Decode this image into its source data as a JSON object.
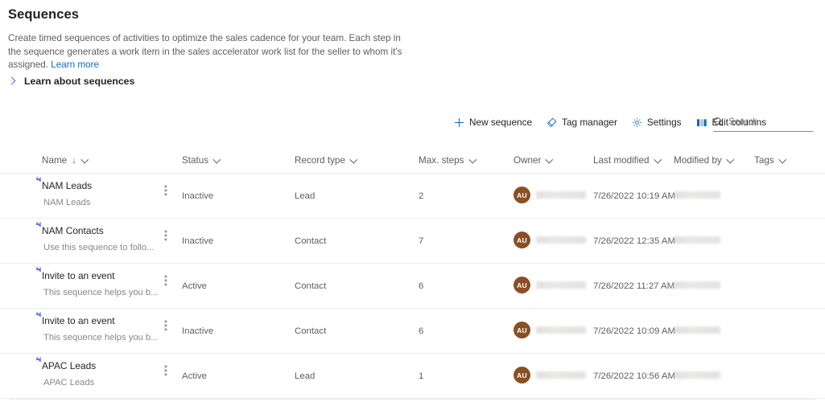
{
  "header": {
    "title": "Sequences",
    "description_part1": "Create timed sequences of activities to optimize the sales cadence for your team. Each step in the sequence generates a work item in the sales accelerator work list for the seller to whom it's assigned. ",
    "learn_more_label": "Learn more"
  },
  "expander": {
    "label": "Learn about sequences",
    "icon": "chevron-right-icon"
  },
  "toolbar": {
    "new_sequence_label": "New sequence",
    "new_sequence_icon": "plus-icon",
    "tag_manager_label": "Tag manager",
    "tag_manager_icon": "tag-icon",
    "settings_label": "Settings",
    "settings_icon": "gear-icon",
    "edit_columns_label": "Edit columns",
    "edit_columns_icon": "columns-icon"
  },
  "search": {
    "placeholder": "Search",
    "icon": "search-icon"
  },
  "table": {
    "columns": [
      {
        "label": "Name",
        "sorted": "↓"
      },
      {
        "label": "Status",
        "sorted": ""
      },
      {
        "label": "Record type",
        "sorted": ""
      },
      {
        "label": "Max. steps",
        "sorted": ""
      },
      {
        "label": "Owner",
        "sorted": ""
      },
      {
        "label": "Last modified",
        "sorted": ""
      },
      {
        "label": "Modified by",
        "sorted": ""
      },
      {
        "label": "Tags",
        "sorted": ""
      }
    ],
    "rows": [
      {
        "name": "NAM Leads",
        "subtitle": "NAM Leads",
        "status": "Inactive",
        "record_type": "Lead",
        "max_steps": "2",
        "owner_initials": "AU",
        "last_modified": "7/26/2022 10:19 AM",
        "tags": ""
      },
      {
        "name": "NAM Contacts",
        "subtitle": "Use this sequence to follo...",
        "status": "Inactive",
        "record_type": "Contact",
        "max_steps": "7",
        "owner_initials": "AU",
        "last_modified": "7/26/2022 12:35 AM",
        "tags": ""
      },
      {
        "name": "Invite to an event",
        "subtitle": "This sequence helps you b...",
        "status": "Active",
        "record_type": "Contact",
        "max_steps": "6",
        "owner_initials": "AU",
        "last_modified": "7/26/2022 11:27 AM",
        "tags": ""
      },
      {
        "name": "Invite to an event",
        "subtitle": "This sequence helps you b...",
        "status": "Inactive",
        "record_type": "Contact",
        "max_steps": "6",
        "owner_initials": "AU",
        "last_modified": "7/26/2022 10:09 AM",
        "tags": ""
      },
      {
        "name": "APAC Leads",
        "subtitle": "APAC Leads",
        "status": "Active",
        "record_type": "Lead",
        "max_steps": "1",
        "owner_initials": "AU",
        "last_modified": "7/26/2022 10:56 AM",
        "tags": ""
      }
    ]
  },
  "colors": {
    "accent": "#0f6cbd",
    "link": "#0f6cbd",
    "avatar": "#8a4f23",
    "expander_chevron": "#4f6bed"
  }
}
